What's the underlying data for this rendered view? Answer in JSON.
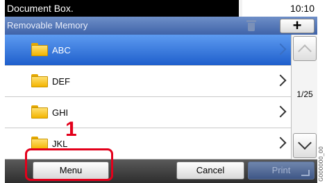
{
  "header": {
    "title": "Document Box.",
    "time": "10:10"
  },
  "subheader": {
    "title": "Removable Memory",
    "trash_icon": "trash-icon",
    "add_label": "+"
  },
  "list": {
    "items": [
      {
        "label": "ABC",
        "selected": true,
        "icon": "folder-icon"
      },
      {
        "label": "DEF",
        "selected": false,
        "icon": "folder-icon"
      },
      {
        "label": "GHI",
        "selected": false,
        "icon": "folder-icon"
      },
      {
        "label": "JKL",
        "selected": false,
        "icon": "folder-icon"
      }
    ]
  },
  "scroll": {
    "page": "1/25"
  },
  "footer": {
    "menu_label": "Menu",
    "cancel_label": "Cancel",
    "print_label": "Print"
  },
  "annotation": {
    "step": "1",
    "code": "G000000_00"
  },
  "colors": {
    "selected_row": "#2f6fdc",
    "callout": "#e3001b",
    "subheader": "#5072b4"
  }
}
